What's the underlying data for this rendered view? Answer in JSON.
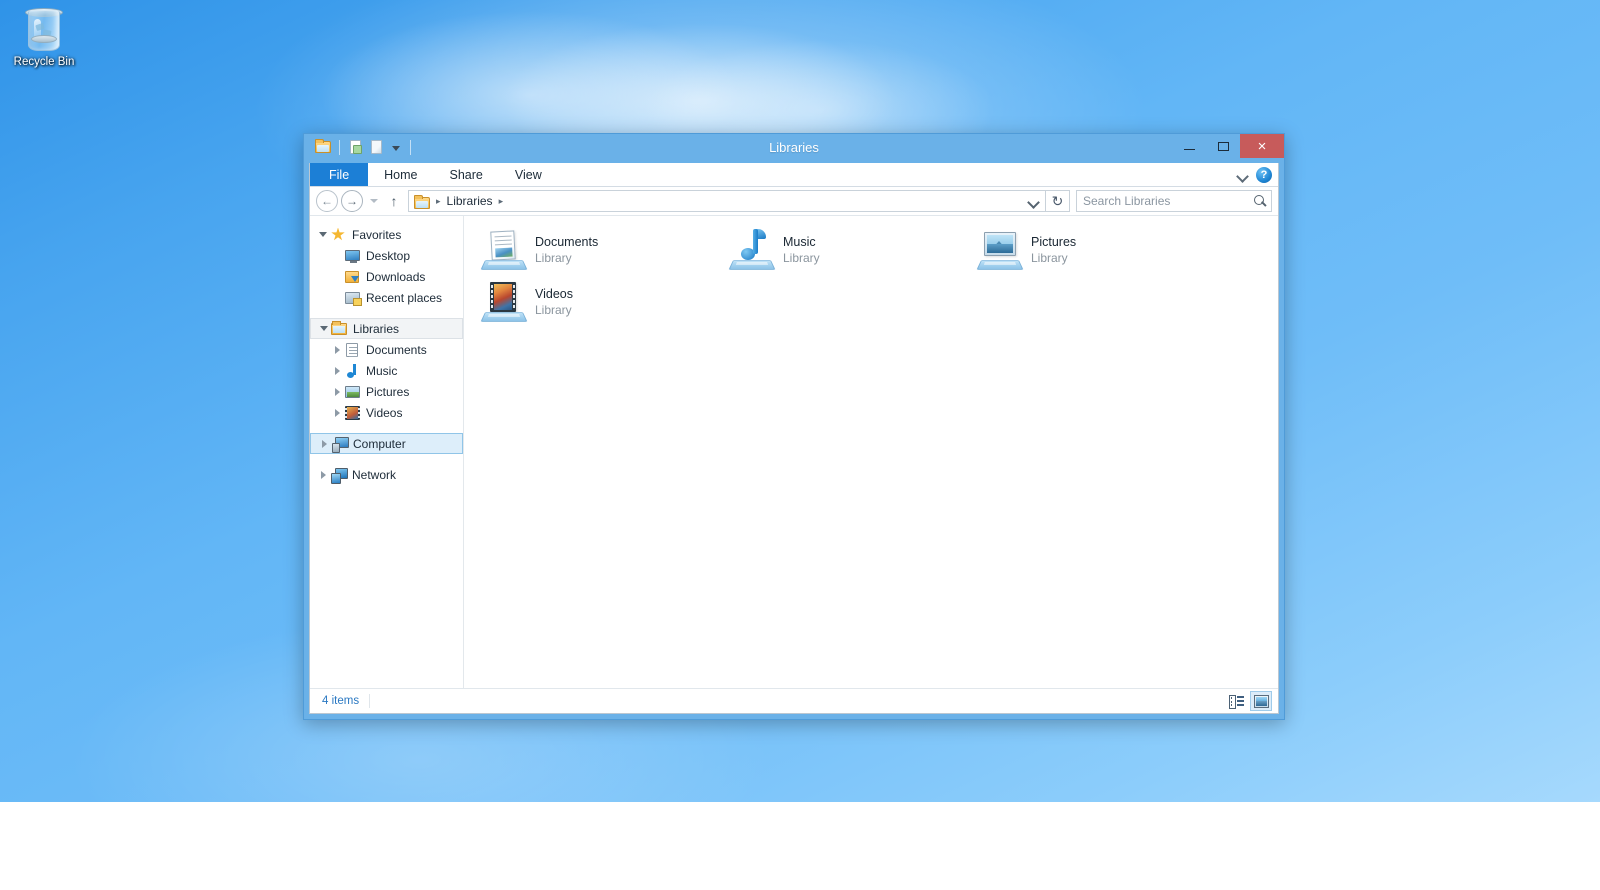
{
  "desktop": {
    "icons": [
      {
        "label": "Recycle Bin",
        "icon": "recycle-bin-icon"
      }
    ]
  },
  "window": {
    "title": "Libraries",
    "quick_access": [
      {
        "name": "libraries-folder-icon",
        "label": "Libraries"
      },
      {
        "name": "properties-icon",
        "label": "Properties"
      },
      {
        "name": "new-folder-icon",
        "label": "New folder"
      },
      {
        "name": "customize-quick-access-caret",
        "label": "Customize Quick Access Toolbar"
      }
    ],
    "controls": {
      "minimize": "Minimize",
      "maximize": "Maximize",
      "close": "Close",
      "close_glyph": "×"
    },
    "ribbon": {
      "tabs": [
        {
          "label": "File",
          "selected": true
        },
        {
          "label": "Home",
          "selected": false
        },
        {
          "label": "Share",
          "selected": false
        },
        {
          "label": "View",
          "selected": false
        }
      ],
      "expand_ribbon": "Expand the Ribbon",
      "help_label": "?"
    },
    "nav": {
      "back": "←",
      "forward": "→",
      "recent_locations": "Recent locations",
      "up": "↑",
      "refresh": "↻",
      "address_icon": "libraries-folder-icon",
      "breadcrumbs": [
        "Libraries"
      ],
      "crumb_separator": "▸",
      "address_dropdown": "Previous Locations"
    },
    "search": {
      "placeholder": "Search Libraries",
      "value": ""
    },
    "navigation_pane": {
      "groups": [
        {
          "label": "Favorites",
          "icon": "star-icon",
          "expanded": true,
          "state": "normal",
          "children": [
            {
              "label": "Desktop",
              "icon": "desktop-icon",
              "expandable": false
            },
            {
              "label": "Downloads",
              "icon": "downloads-icon",
              "expandable": false
            },
            {
              "label": "Recent places",
              "icon": "recent-places-icon",
              "expandable": false
            }
          ]
        },
        {
          "label": "Libraries",
          "icon": "libraries-icon",
          "expanded": true,
          "state": "soft-selected",
          "children": [
            {
              "label": "Documents",
              "icon": "documents-icon",
              "expandable": true
            },
            {
              "label": "Music",
              "icon": "music-icon",
              "expandable": true
            },
            {
              "label": "Pictures",
              "icon": "pictures-icon",
              "expandable": true
            },
            {
              "label": "Videos",
              "icon": "videos-icon",
              "expandable": true
            }
          ]
        },
        {
          "label": "Computer",
          "icon": "computer-icon",
          "expanded": false,
          "state": "selected",
          "children": []
        },
        {
          "label": "Network",
          "icon": "network-icon",
          "expanded": false,
          "state": "normal",
          "children": []
        }
      ]
    },
    "content": {
      "items": [
        {
          "name": "Documents",
          "type": "Library",
          "icon": "documents-library-icon"
        },
        {
          "name": "Music",
          "type": "Library",
          "icon": "music-library-icon"
        },
        {
          "name": "Pictures",
          "type": "Library",
          "icon": "pictures-library-icon"
        },
        {
          "name": "Videos",
          "type": "Library",
          "icon": "videos-library-icon"
        }
      ]
    },
    "statusbar": {
      "item_count": "4 items",
      "views": [
        {
          "name": "details-view-button",
          "label": "Details view",
          "selected": false
        },
        {
          "name": "large-icons-view-button",
          "label": "Large icons view",
          "selected": true
        }
      ]
    }
  },
  "colors": {
    "title_bar": "#6ab1e8",
    "file_tab": "#1c7fd6",
    "close_button": "#c75b5b",
    "selection": "#ddeefa",
    "status_text": "#2a78c2",
    "desktop_blue": "#62b6f6"
  }
}
